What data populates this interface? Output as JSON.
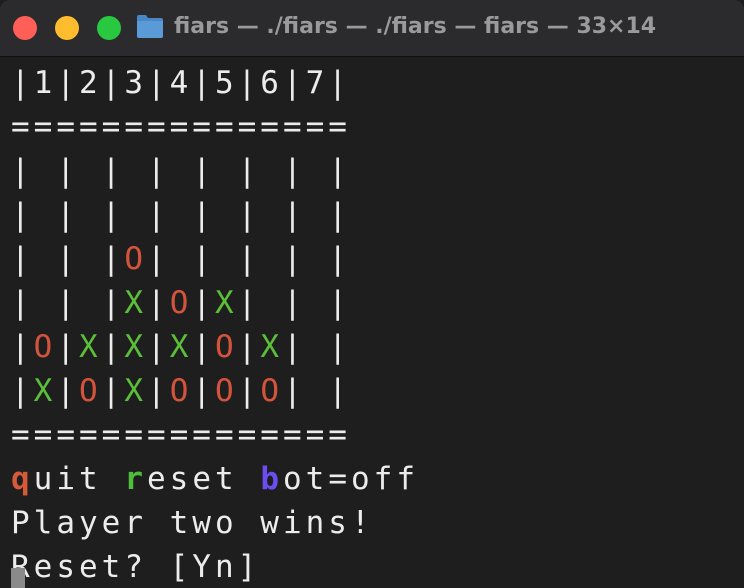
{
  "window": {
    "title": "fiars — ./fiars — ./fiars — fiars — 33×14",
    "colors": {
      "close": "#ff5f57",
      "minimize": "#febc2e",
      "maximize": "#28c840"
    }
  },
  "terminal": {
    "header_row": "|1|2|3|4|5|6|7|",
    "separator_top": "===============",
    "board": [
      [
        " ",
        " ",
        " ",
        " ",
        " ",
        " ",
        " "
      ],
      [
        " ",
        " ",
        " ",
        " ",
        " ",
        " ",
        " "
      ],
      [
        " ",
        " ",
        "O",
        " ",
        " ",
        " ",
        " "
      ],
      [
        " ",
        " ",
        "X",
        "O",
        "X",
        " ",
        " "
      ],
      [
        "O",
        "X",
        "X",
        "X",
        "O",
        "X",
        " "
      ],
      [
        "X",
        "O",
        "X",
        "O",
        "O",
        "O",
        " "
      ]
    ],
    "separator_bottom": "===============",
    "menu": {
      "quit_key": "q",
      "quit_rest": "uit",
      "reset_key": "r",
      "reset_rest": "eset",
      "bot_key": "b",
      "bot_rest": "ot=off"
    },
    "status": "Player two wins!",
    "prompt": "Reset? [Yn]",
    "colors": {
      "X": "#5cbf3a",
      "O": "#d4533c",
      "text": "#ececec",
      "quit_key": "#d45a3a",
      "reset_key": "#4fbf3a",
      "bot_key": "#6b4df0"
    }
  }
}
